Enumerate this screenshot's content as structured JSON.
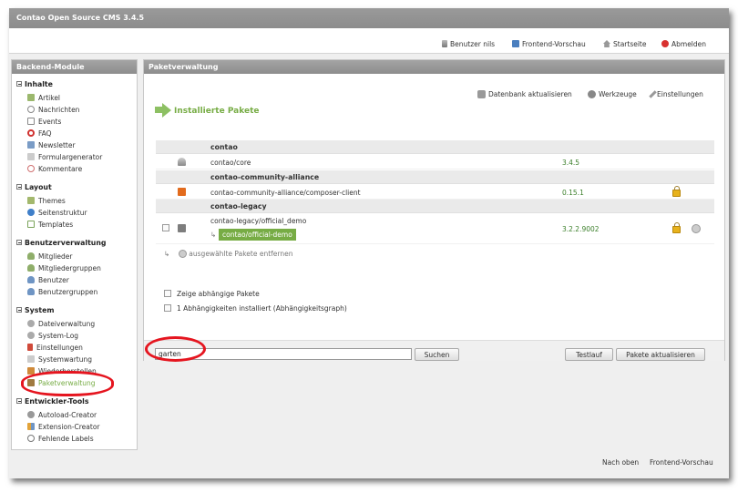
{
  "window": {
    "title": "Contao Open Source CMS 3.4.5"
  },
  "topnav": {
    "user": "Benutzer nils",
    "preview": "Frontend-Vorschau",
    "home": "Startseite",
    "logout": "Abmelden"
  },
  "sidebar": {
    "title": "Backend-Module",
    "groups": [
      {
        "title": "Inhalte",
        "items": [
          "Artikel",
          "Nachrichten",
          "Events",
          "FAQ",
          "Newsletter",
          "Formulargenerator",
          "Kommentare"
        ]
      },
      {
        "title": "Layout",
        "items": [
          "Themes",
          "Seitenstruktur",
          "Templates"
        ]
      },
      {
        "title": "Benutzerverwaltung",
        "items": [
          "Mitglieder",
          "Mitgliedergruppen",
          "Benutzer",
          "Benutzergruppen"
        ]
      },
      {
        "title": "System",
        "items": [
          "Dateiverwaltung",
          "System-Log",
          "Einstellungen",
          "Systemwartung",
          "Wiederherstellen",
          "Paketverwaltung"
        ]
      },
      {
        "title": "Entwickler-Tools",
        "items": [
          "Autoload-Creator",
          "Extension-Creator",
          "Fehlende Labels"
        ]
      }
    ],
    "active_item": "Paketverwaltung"
  },
  "main": {
    "title": "Paketverwaltung",
    "tools": {
      "db_update": "Datenbank aktualisieren",
      "tools": "Werkzeuge",
      "settings": "Einstellungen"
    },
    "section_title": "Installierte Pakete",
    "groups": [
      {
        "name": "contao",
        "packages": [
          {
            "name": "contao/core",
            "version": "3.4.5"
          }
        ]
      },
      {
        "name": "contao-community-alliance",
        "packages": [
          {
            "name": "contao-community-alliance/composer-client",
            "version": "0.15.1"
          }
        ]
      },
      {
        "name": "contao-legacy",
        "packages": [
          {
            "name": "contao-legacy/official_demo",
            "version": "3.2.2.9002",
            "alias_prefix": "↳",
            "alias": "contao/official-demo"
          }
        ]
      }
    ],
    "remove_prefix": "↳",
    "remove_label": "ausgewählte Pakete entfernen",
    "options": {
      "show_dependants": "Zeige abhängige Pakete",
      "dependencies": "1 Abhängigkeiten installiert (Abhängigkeitsgraph)"
    },
    "search": {
      "value": "garten",
      "button": "Suchen"
    },
    "buttons": {
      "testrun": "Testlauf",
      "update": "Pakete aktualisieren"
    }
  },
  "footer": {
    "top": "Nach oben",
    "preview": "Frontend-Vorschau"
  },
  "colors": {
    "accent_green": "#77ac45",
    "version_green": "#3b7f2a",
    "annotation_red": "#e5151f",
    "header_gray": "#8d8d8d"
  }
}
